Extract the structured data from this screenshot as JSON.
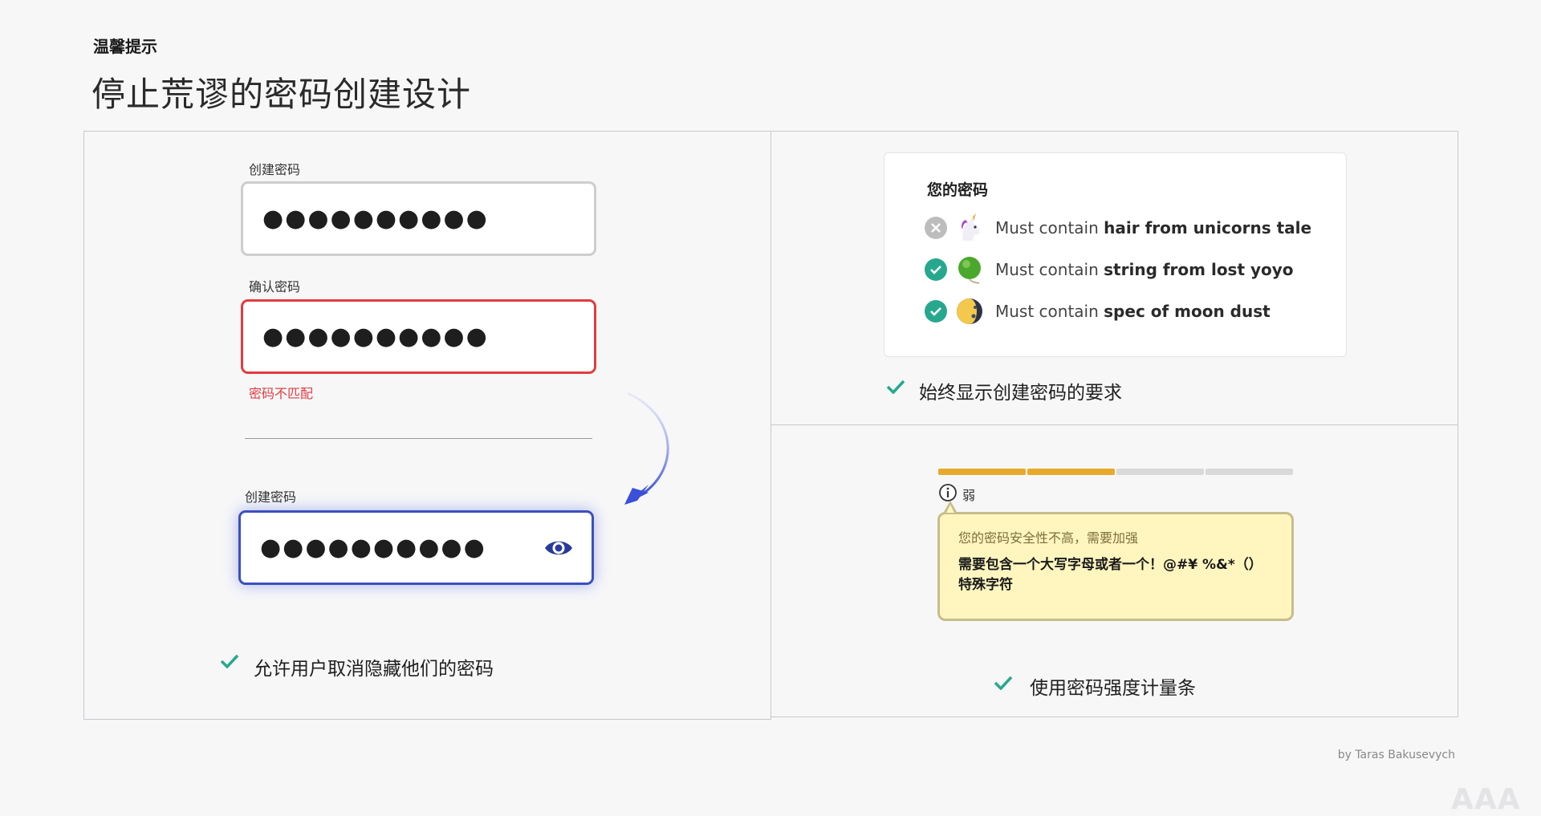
{
  "header": {
    "eyebrow": "温馨提示",
    "title": "停止荒谬的密码创建设计"
  },
  "left_panel": {
    "field1": {
      "label": "创建密码",
      "value": "●●●●●●●●●●"
    },
    "field2": {
      "label": "确认密码",
      "value": "●●●●●●●●●●",
      "error": "密码不匹配"
    },
    "field3": {
      "label": "创建密码",
      "value": "●●●●●●●●●●",
      "toggle_icon": "eye-icon"
    },
    "caption": "允许用户取消隐藏他们的密码"
  },
  "top_right_panel": {
    "card_title": "您的密码",
    "requirements": [
      {
        "prefix": "Must contain ",
        "bold": "hair from unicorns tale",
        "status": "fail",
        "emoji": "unicorn-icon"
      },
      {
        "prefix": "Must contain ",
        "bold": "string from lost yoyo",
        "status": "ok",
        "emoji": "yoyo-icon"
      },
      {
        "prefix": "Must contain ",
        "bold": "spec of moon dust",
        "status": "ok",
        "emoji": "moon-icon"
      }
    ],
    "caption": "始终显示创建密码的要求"
  },
  "bottom_right_panel": {
    "meter": {
      "segments": 4,
      "filled": 2,
      "filled_color": "#e8a92b",
      "empty_color": "#d9d9d9"
    },
    "strength_label": "弱",
    "tooltip": {
      "heading": "您的密码安全性不高，需要加强",
      "body": "需要包含一个大写字母或者一个！@#¥ %&*（）特殊字符"
    },
    "caption": "使用密码强度计量条"
  },
  "colors": {
    "accent_blue": "#3c4fbf",
    "error_red": "#e23b3f",
    "check_green": "#27a88e"
  },
  "credit": "by Taras Bakusevych",
  "watermark": "AAA"
}
